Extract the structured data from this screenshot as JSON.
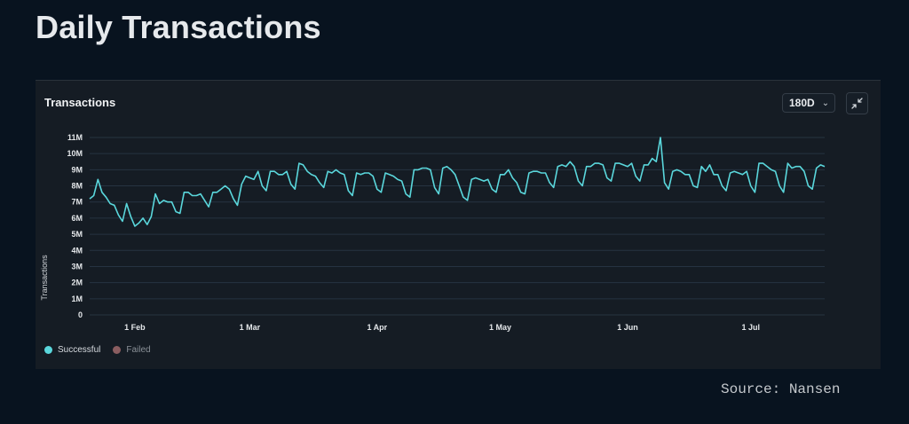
{
  "page": {
    "title": "Daily Transactions",
    "source": "Source: Nansen"
  },
  "panel": {
    "title": "Transactions",
    "range_select": "180D",
    "collapse_icon": "collapse-arrows-icon"
  },
  "colors": {
    "successful": "#5ad7dc",
    "failed": "#8a5d60",
    "grid": "#263341",
    "background": "#151c24"
  },
  "chart_data": {
    "type": "line",
    "title": "Transactions",
    "xlabel": "",
    "ylabel": "Transactions",
    "ylim": [
      0,
      11000000
    ],
    "yticks": [
      "0",
      "1M",
      "2M",
      "3M",
      "4M",
      "5M",
      "6M",
      "7M",
      "8M",
      "9M",
      "10M",
      "11M"
    ],
    "xticks": [
      "1 Feb",
      "1 Mar",
      "1 Apr",
      "1 May",
      "1 Jun",
      "1 Jul"
    ],
    "x_start": "2023-01-21",
    "grid": true,
    "legend_position": "bottom-left",
    "series": [
      {
        "name": "Successful",
        "values": [
          7.2,
          7.4,
          8.4,
          7.6,
          7.3,
          6.9,
          6.8,
          6.2,
          5.8,
          6.9,
          6.1,
          5.5,
          5.7,
          6.0,
          5.6,
          6.1,
          7.5,
          6.9,
          7.1,
          7.0,
          7.0,
          6.4,
          6.3,
          7.6,
          7.6,
          7.4,
          7.4,
          7.5,
          7.1,
          6.7,
          7.6,
          7.6,
          7.8,
          8.0,
          7.8,
          7.2,
          6.8,
          8.1,
          8.6,
          8.5,
          8.4,
          8.9,
          8.0,
          7.7,
          8.9,
          8.9,
          8.7,
          8.7,
          8.9,
          8.1,
          7.8,
          9.4,
          9.3,
          8.9,
          8.7,
          8.6,
          8.2,
          7.9,
          8.9,
          8.8,
          9.0,
          8.8,
          8.7,
          7.7,
          7.4,
          8.8,
          8.7,
          8.8,
          8.8,
          8.6,
          7.8,
          7.6,
          8.8,
          8.7,
          8.6,
          8.4,
          8.3,
          7.5,
          7.3,
          9.0,
          9.0,
          9.1,
          9.1,
          9.0,
          7.9,
          7.5,
          9.1,
          9.2,
          9.0,
          8.7,
          8.0,
          7.3,
          7.1,
          8.4,
          8.5,
          8.4,
          8.3,
          8.4,
          7.8,
          7.6,
          8.7,
          8.7,
          9.0,
          8.5,
          8.2,
          7.6,
          7.5,
          8.8,
          8.9,
          8.9,
          8.8,
          8.8,
          8.2,
          7.9,
          9.2,
          9.3,
          9.2,
          9.5,
          9.2,
          8.3,
          8.0,
          9.2,
          9.2,
          9.4,
          9.4,
          9.3,
          8.5,
          8.3,
          9.4,
          9.4,
          9.3,
          9.2,
          9.4,
          8.6,
          8.3,
          9.3,
          9.3,
          9.7,
          9.5,
          11.0,
          8.2,
          7.8,
          8.9,
          9.0,
          8.9,
          8.7,
          8.7,
          8.0,
          7.9,
          9.2,
          8.9,
          9.3,
          8.7,
          8.7,
          8.0,
          7.7,
          8.8,
          8.9,
          8.8,
          8.7,
          8.9,
          8.0,
          7.6,
          9.4,
          9.4,
          9.2,
          9.0,
          8.9,
          8.0,
          7.6,
          9.4,
          9.1,
          9.2,
          9.2,
          8.9,
          8.0,
          7.8,
          9.1,
          9.3,
          9.2
        ]
      }
    ],
    "legend": [
      {
        "name": "Successful",
        "active": true
      },
      {
        "name": "Failed",
        "active": false
      }
    ]
  }
}
